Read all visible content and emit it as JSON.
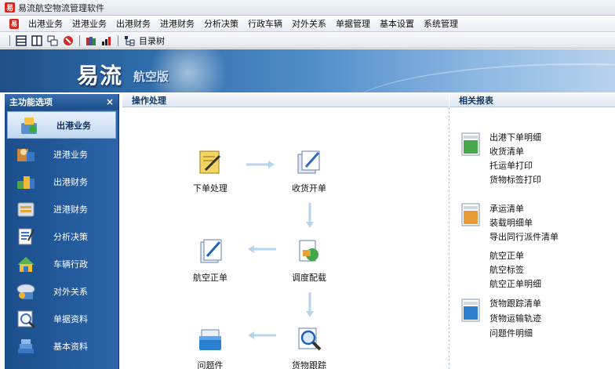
{
  "window": {
    "title": "易流航空物流管理软件",
    "app_icon": "易"
  },
  "menubar": {
    "logo": "易",
    "items": [
      "出港业务",
      "进港业务",
      "出港财务",
      "进港财务",
      "分析决策",
      "行政车辆",
      "对外关系",
      "单据管理",
      "基本设置",
      "系统管理"
    ]
  },
  "toolbar": {
    "tree_label": "目录树"
  },
  "banner": {
    "brand": "易流",
    "edition": "航空版"
  },
  "sidebar": {
    "title": "主功能选项",
    "close": "×",
    "items": [
      {
        "label": "出港业务",
        "icon": "outbound-icon"
      },
      {
        "label": "进港业务",
        "icon": "inbound-icon"
      },
      {
        "label": "出港财务",
        "icon": "outbound-finance-icon"
      },
      {
        "label": "进港财务",
        "icon": "inbound-finance-icon"
      },
      {
        "label": "分析决策",
        "icon": "analysis-icon"
      },
      {
        "label": "车辆行政",
        "icon": "vehicle-icon"
      },
      {
        "label": "对外关系",
        "icon": "relations-icon"
      },
      {
        "label": "单据资料",
        "icon": "documents-icon"
      },
      {
        "label": "基本资料",
        "icon": "basic-data-icon"
      }
    ],
    "active_index": 0
  },
  "ops": {
    "title": "操作处理",
    "nodes": {
      "order": "下单处理",
      "receive": "收货开单",
      "air_waybill": "航空正单",
      "dispatch": "调度配载",
      "issues": "问题件",
      "tracking": "货物跟踪"
    }
  },
  "reports": {
    "title": "相关报表",
    "group1": [
      "出港下单明细",
      "收货清单",
      "托运单打印",
      "货物标签打印"
    ],
    "group2": [
      "承运清单",
      "装载明细单",
      "导出同行派件清单",
      "航空正单",
      "航空标签",
      "航空正单明细"
    ],
    "group3": [
      "货物跟踪清单",
      "货物运输轨迹",
      "问题件明细"
    ]
  },
  "colors": {
    "sidebar": "#1b4e8c",
    "banner": "#2d6aa8",
    "accent": "#d8261f"
  }
}
